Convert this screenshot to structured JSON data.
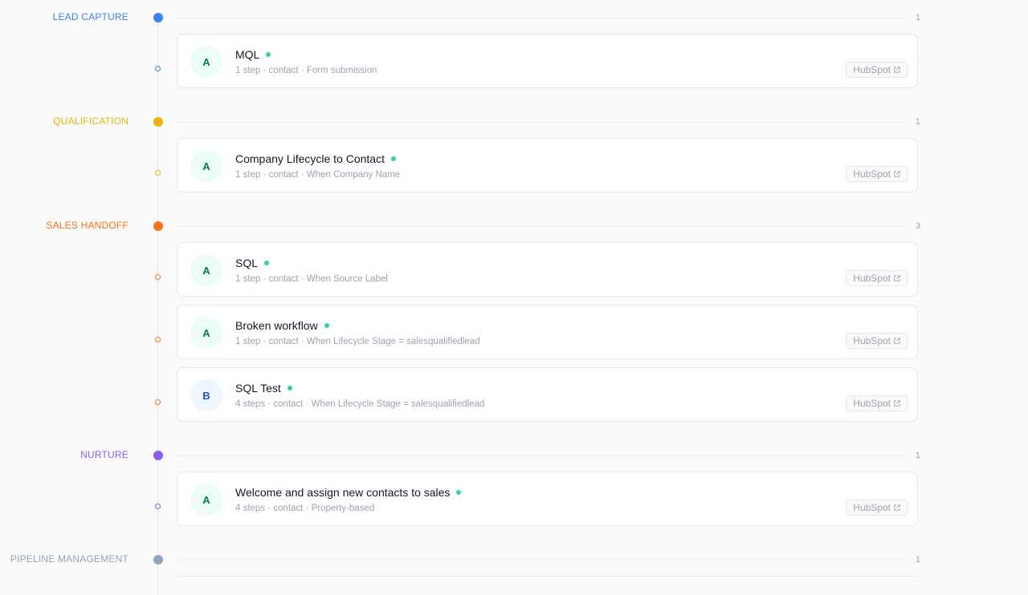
{
  "stages": [
    {
      "label": "LEAD CAPTURE",
      "color": "#3b82f6",
      "count": "1",
      "workflows": [
        {
          "avatar": "A",
          "title": "MQL",
          "meta": "1 step · contact · Form submission",
          "button": "HubSpot"
        }
      ]
    },
    {
      "label": "QUALIFICATION",
      "color": "#eab308",
      "count": "1",
      "workflows": [
        {
          "avatar": "A",
          "title": "Company Lifecycle to Contact",
          "meta": "1 step · contact · When Company Name",
          "button": "HubSpot"
        }
      ]
    },
    {
      "label": "SALES HANDOFF",
      "color": "#f97316",
      "count": "3",
      "workflows": [
        {
          "avatar": "A",
          "title": "SQL",
          "meta": "1 step · contact · When Source Label",
          "button": "HubSpot"
        },
        {
          "avatar": "A",
          "title": "Broken workflow",
          "meta": "1 step · contact · When Lifecycle Stage = salesqualifiedlead",
          "button": "HubSpot"
        },
        {
          "avatar": "B",
          "title": "SQL Test",
          "meta": "4 steps · contact · When Lifecycle Stage = salesqualifiedlead",
          "button": "HubSpot"
        }
      ]
    },
    {
      "label": "NURTURE",
      "color": "#8b5cf6",
      "count": "1",
      "workflows": [
        {
          "avatar": "A",
          "title": "Welcome and assign new contacts to sales",
          "meta": "4 steps · contact · Property-based",
          "button": "HubSpot"
        }
      ]
    },
    {
      "label": "PIPELINE MANAGEMENT",
      "color": "#94a3b8",
      "count": "1",
      "workflows": []
    }
  ]
}
